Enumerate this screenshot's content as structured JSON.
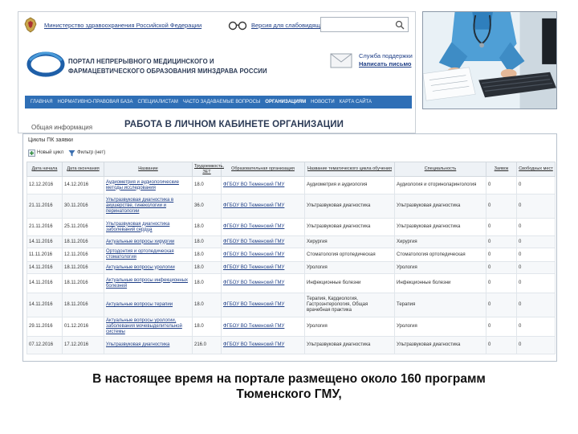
{
  "portal": {
    "ministry_link": "Министерство здравоохранения Российской Федерации",
    "vision_link": "Версия для слабовидящих",
    "title_line1": "ПОРТАЛ НЕПРЕРЫВНОГО МЕДИЦИНСКОГО И",
    "title_line2": "ФАРМАЦЕВТИЧЕСКОГО ОБРАЗОВАНИЯ МИНЗДРАВА РОССИИ",
    "support_label": "Служба поддержки",
    "support_link": "Написать письмо",
    "nav": [
      "Главная",
      "Нормативно-правовая база",
      "Специалистам",
      "Часто задаваемые вопросы",
      "Организациям",
      "Новости",
      "Карта сайта"
    ],
    "nav_active_index": 4,
    "side_info": "Общая информация",
    "page_heading": "РАБОТА В ЛИЧНОМ КАБИНЕТЕ ОРГАНИЗАЦИИ"
  },
  "programs": {
    "panel_title": "Циклы ПК заявки",
    "toolbar": {
      "add_label": "Новый цикл",
      "filter_label": "Фильтр (нет)"
    },
    "columns": [
      "Дата начала",
      "Дата окончания",
      "Название",
      "Трудоемкость, ЗЕТ",
      "Образовательная организация",
      "Название тематического цикла обучения",
      "Специальность",
      "Заявок",
      "Свободных мест"
    ],
    "rows": [
      [
        "12.12.2016",
        "14.12.2016",
        "Аудиометрия и аудиологические методы исследования",
        "18.0",
        "ФГБОУ ВО Тюменский ГМУ",
        "Аудиометрия и аудиология",
        "Аудиология и оториноларингология",
        "0",
        "0"
      ],
      [
        "21.11.2016",
        "30.11.2016",
        "Ультразвуковая диагностика в акушерстве, гинекологии и перинатологии",
        "36.0",
        "ФГБОУ ВО Тюменский ГМУ",
        "Ультразвуковая диагностика",
        "Ультразвуковая диагностика",
        "0",
        "0"
      ],
      [
        "21.11.2016",
        "25.11.2016",
        "Ультразвуковая диагностика заболеваний сердца",
        "18.0",
        "ФГБОУ ВО Тюменский ГМУ",
        "Ультразвуковая диагностика",
        "Ультразвуковая диагностика",
        "0",
        "0"
      ],
      [
        "14.11.2016",
        "18.11.2016",
        "Актуальные вопросы хирургии",
        "18.0",
        "ФГБОУ ВО Тюменский ГМУ",
        "Хирургия",
        "Хирургия",
        "0",
        "0"
      ],
      [
        "11.11.2016",
        "12.11.2016",
        "Ортодонтия и ортопедическая стоматология",
        "18.0",
        "ФГБОУ ВО Тюменский ГМУ",
        "Стоматология ортопедическая",
        "Стоматология ортопедическая",
        "0",
        "0"
      ],
      [
        "14.11.2016",
        "18.11.2016",
        "Актуальные вопросы урологии",
        "18.0",
        "ФГБОУ ВО Тюменский ГМУ",
        "Урология",
        "Урология",
        "0",
        "0"
      ],
      [
        "14.11.2016",
        "18.11.2016",
        "Актуальные вопросы инфекционных болезней",
        "18.0",
        "ФГБОУ ВО Тюменский ГМУ",
        "Инфекционные болезни",
        "Инфекционные болезни",
        "0",
        "0"
      ],
      [
        "14.11.2016",
        "18.11.2016",
        "Актуальные вопросы терапии",
        "18.0",
        "ФГБОУ ВО Тюменский ГМУ",
        "Терапия, Кардиология, Гастроэнтерология, Общая врачебная практика",
        "Терапия",
        "0",
        "0"
      ],
      [
        "29.11.2016",
        "01.12.2016",
        "Актуальные вопросы урологии, заболевания мочевыделительной системы",
        "18.0",
        "ФГБОУ ВО Тюменский ГМУ",
        "Урология",
        "Урология",
        "0",
        "0"
      ],
      [
        "07.12.2016",
        "17.12.2016",
        "Ультразвуковая диагностика",
        "216.0",
        "ФГБОУ ВО Тюменский ГМУ",
        "Ультразвуковая диагностика",
        "Ультразвуковая диагностика",
        "0",
        "0"
      ]
    ]
  },
  "caption": {
    "line1": "В настоящее время на портале размещено около 160 программ",
    "line2": "Тюменского ГМУ,"
  }
}
